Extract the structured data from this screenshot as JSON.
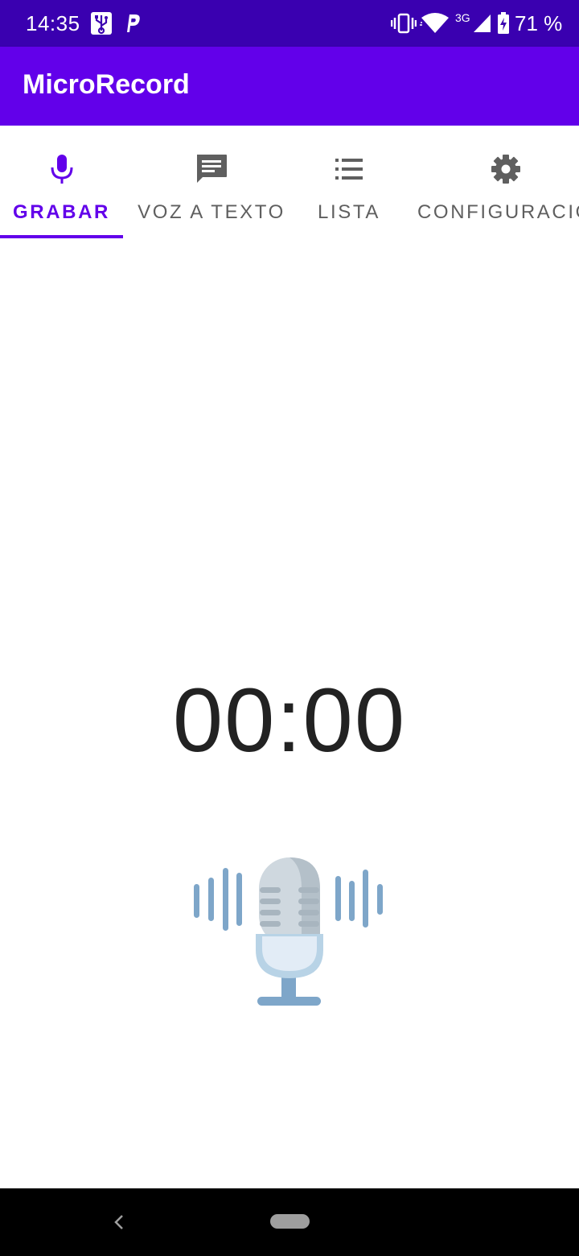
{
  "status_bar": {
    "time": "14:35",
    "network_label": "3G",
    "battery_percent": "71 %",
    "icons": [
      "usb-icon",
      "parking-icon",
      "vibrate-icon",
      "wifi-icon",
      "signal-icon",
      "battery-charging-icon"
    ]
  },
  "app_bar": {
    "title": "MicroRecord",
    "color": "#6200ea"
  },
  "tabs": [
    {
      "label": "GRABAR",
      "icon": "mic-icon",
      "active": true
    },
    {
      "label": "VOZ A TEXTO",
      "icon": "message-text-icon",
      "active": false
    },
    {
      "label": "LISTA",
      "icon": "list-icon",
      "active": false
    },
    {
      "label": "CONFIGURACIÓ",
      "icon": "settings-icon",
      "active": false
    }
  ],
  "recorder": {
    "timer": "00:00",
    "illustration": "microphone-soundwave-icon"
  },
  "colors": {
    "status_bar": "#3a00b0",
    "accent": "#6200ea",
    "inactive_tab": "#5f5f5f"
  },
  "nav_bar": {
    "back": "back-icon",
    "home": "home-pill"
  }
}
